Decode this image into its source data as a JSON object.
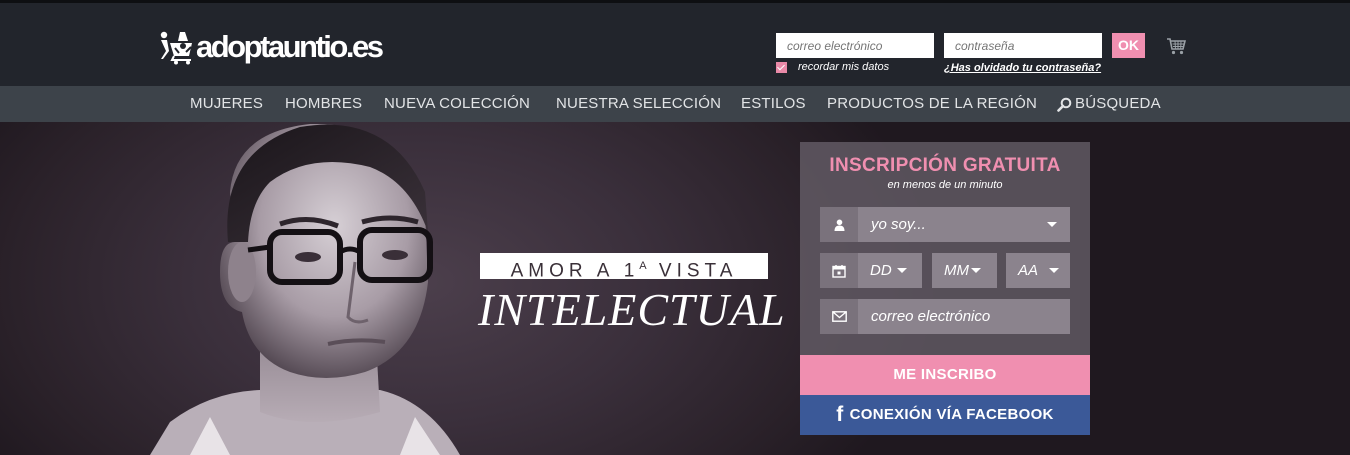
{
  "header": {
    "logo_text": "adoptauntio.es",
    "login": {
      "email_placeholder": "correo electrónico",
      "password_placeholder": "contraseña",
      "ok_label": "OK",
      "remember_label": "recordar mis datos",
      "remember_checked": true,
      "forgot_label": "¿Has olvidado tu contraseña?"
    }
  },
  "nav": {
    "items": [
      "MUJERES",
      "HOMBRES",
      "NUEVA COLECCIÓN",
      "NUESTRA SELECCIÓN",
      "ESTILOS",
      "PRODUCTOS DE LA REGIÓN"
    ],
    "search_label": "BÚSQUEDA"
  },
  "hero": {
    "tagline_prefix": "AMOR A 1",
    "tagline_sup": "A",
    "tagline_suffix": " VISTA",
    "tagline_big": "INTELECTUAL"
  },
  "signup": {
    "title": "INSCRIPCIÓN GRATUITA",
    "subtitle": "en menos de un minuto",
    "gender_select": "yo soy...",
    "day_select": "DD",
    "month_select": "MM",
    "year_select": "AA",
    "email_placeholder": "correo electrónico",
    "register_label": "ME INSCRIBO",
    "facebook_label": "CONEXIÓN VÍA FACEBOOK",
    "facebook_glyph": "f"
  },
  "colors": {
    "accent_pink": "#f08fb0",
    "facebook_blue": "#3b5998",
    "header_bg": "#22252c",
    "nav_bg": "#3d434a"
  },
  "icons": [
    "logo-mark-icon",
    "cart-icon",
    "search-icon",
    "user-icon",
    "calendar-icon",
    "envelope-icon",
    "caret-down-icon"
  ]
}
